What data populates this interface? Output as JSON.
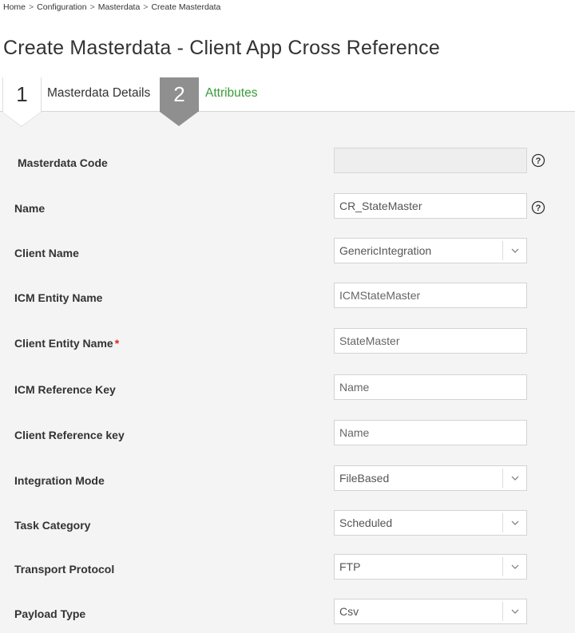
{
  "breadcrumb": {
    "items": [
      "Home",
      "Configuration",
      "Masterdata",
      "Create Masterdata"
    ],
    "separator": ">"
  },
  "page": {
    "title": "Create Masterdata - Client App Cross Reference"
  },
  "steps": [
    {
      "number": "1",
      "label": "Masterdata Details",
      "state": "active"
    },
    {
      "number": "2",
      "label": "Attributes",
      "state": "inactive"
    }
  ],
  "form": {
    "masterdata_code": {
      "label": "Masterdata Code",
      "value": "",
      "disabled": true,
      "help_icon": "question-circle-icon"
    },
    "name": {
      "label": "Name",
      "value": "CR_StateMaster",
      "help_icon": "question-circle-icon"
    },
    "client_name": {
      "label": "Client Name",
      "value": "GenericIntegration",
      "icon": "chevron-down-icon"
    },
    "icm_entity_name": {
      "label": "ICM Entity Name",
      "placeholder": "ICMStateMaster"
    },
    "client_entity_name": {
      "label": "Client Entity Name",
      "required_mark": "*",
      "placeholder": "StateMaster"
    },
    "icm_reference_key": {
      "label": "ICM Reference Key",
      "placeholder": "Name"
    },
    "client_reference_key": {
      "label": "Client Reference key",
      "placeholder": "Name"
    },
    "integration_mode": {
      "label": "Integration Mode",
      "value": "FileBased",
      "icon": "chevron-down-icon"
    },
    "task_category": {
      "label": "Task Category",
      "value": "Scheduled",
      "icon": "chevron-down-icon"
    },
    "transport_protocol": {
      "label": "Transport Protocol",
      "value": "FTP",
      "icon": "chevron-down-icon"
    },
    "payload_type": {
      "label": "Payload Type",
      "value": "Csv",
      "icon": "chevron-down-icon"
    }
  },
  "colors": {
    "step_active_bg": "#ffffff",
    "step_inactive_bg": "#8f8f8f",
    "step_inactive_label": "#3a9a3a",
    "required": "#d9261c",
    "panel_bg": "#f4f4f4"
  }
}
